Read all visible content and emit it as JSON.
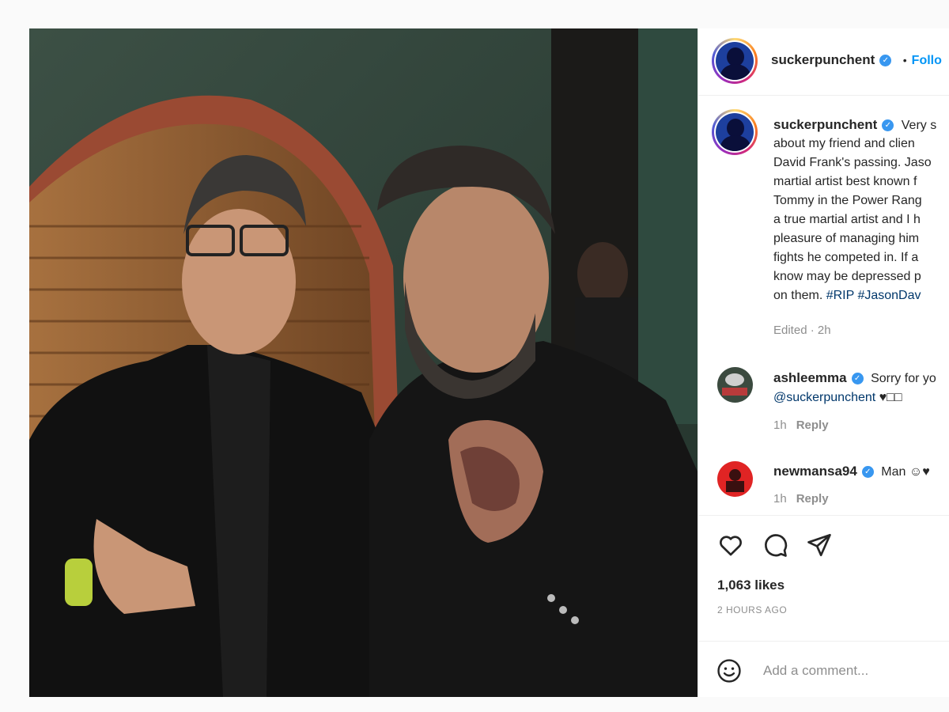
{
  "post": {
    "username": "suckerpunchent",
    "follow_label": "Follo",
    "dot": "•"
  },
  "caption": {
    "username": "suckerpunchent",
    "lines": [
      "Very s",
      "about my friend and clien",
      "David Frank's passing. Jaso",
      "martial artist best known f",
      "Tommy in the Power Rang",
      "a true martial artist and I h",
      "pleasure of managing him",
      "fights he competed in. If a",
      "know may be depressed p",
      "on them."
    ],
    "hashtags": [
      "#RIP",
      "#JasonDav"
    ],
    "meta": "Edited · 2h"
  },
  "comments": [
    {
      "username": "ashleemma",
      "text_line1": "Sorry for yo",
      "text_line2_mention": "@suckerpunchent",
      "text_line2_rest": " ♥□□",
      "time": "1h",
      "reply": "Reply"
    },
    {
      "username": "newmansa94",
      "text_line1": "Man ☺♥",
      "time": "1h",
      "reply": "Reply"
    }
  ],
  "actions": {
    "likes": "1,063 likes",
    "time_ago": "2 HOURS AGO",
    "comment_placeholder": "Add a comment..."
  },
  "icons": {
    "like": "heart-icon",
    "comment": "comment-icon",
    "share": "paper-plane-icon",
    "emoji": "emoji-icon",
    "verified": "verified-badge-icon"
  },
  "colors": {
    "link": "#00376b",
    "follow": "#0095f6",
    "verified": "#3897f0",
    "muted": "#8e8e8e"
  }
}
